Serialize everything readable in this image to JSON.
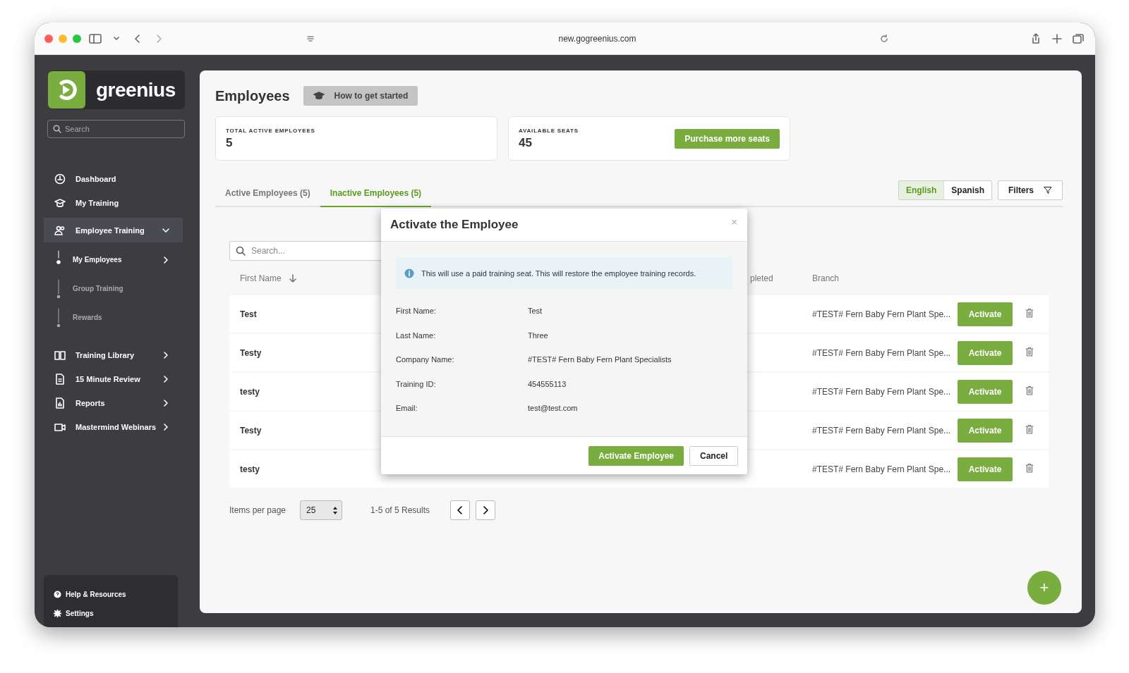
{
  "browser": {
    "url": "new.gogreenius.com"
  },
  "sidebar": {
    "logo_text": "greenius",
    "search_placeholder": "Search",
    "nav": [
      {
        "label": "Dashboard",
        "selected": false
      },
      {
        "label": "My Training",
        "selected": false
      },
      {
        "label": "Employee Training",
        "selected": true,
        "expanded": true,
        "children": [
          {
            "label": "My Employees",
            "selected": true
          },
          {
            "label": "Group Training",
            "selected": false
          },
          {
            "label": "Rewards",
            "selected": false
          }
        ]
      },
      {
        "label": "Training Library",
        "selected": false,
        "expanded": false
      },
      {
        "label": "15 Minute Review",
        "selected": false,
        "expanded": false
      },
      {
        "label": "Reports",
        "selected": false,
        "expanded": false
      },
      {
        "label": "Mastermind Webinars",
        "selected": false,
        "expanded": false
      }
    ],
    "footer": [
      {
        "label": "Help & Resources"
      },
      {
        "label": "Settings"
      }
    ]
  },
  "main": {
    "title": "Employees",
    "help_button": "How to get started",
    "stats": [
      {
        "label": "TOTAL ACTIVE EMPLOYEES",
        "value": "5"
      },
      {
        "label": "AVAILABLE SEATS",
        "value": "45",
        "action": "Purchase more seats"
      }
    ],
    "tabs": [
      {
        "label": "Active Employees (5)",
        "selected": false
      },
      {
        "label": "Inactive Employees (5)",
        "selected": true
      }
    ],
    "languages": [
      {
        "label": "English",
        "selected": true
      },
      {
        "label": "Spanish",
        "selected": false
      }
    ],
    "filters_button": "Filters",
    "table": {
      "search_placeholder": "Search...",
      "columns": [
        {
          "label": "First Name",
          "sorted": true
        },
        {
          "label": "pleted",
          "sorted": false
        },
        {
          "label": "Branch",
          "sorted": false
        }
      ],
      "rows": [
        {
          "first_name": "Test",
          "branch": "#TEST# Fern Baby Fern Plant Spe...",
          "action": "Activate"
        },
        {
          "first_name": "Testy",
          "branch": "#TEST# Fern Baby Fern Plant Spe...",
          "action": "Activate"
        },
        {
          "first_name": "testy",
          "branch": "#TEST# Fern Baby Fern Plant Spe...",
          "action": "Activate"
        },
        {
          "first_name": "Testy",
          "branch": "#TEST# Fern Baby Fern Plant Spe...",
          "action": "Activate"
        },
        {
          "first_name": "testy",
          "branch": "#TEST# Fern Baby Fern Plant Spe...",
          "action": "Activate"
        }
      ]
    },
    "pagination": {
      "label": "Items per page",
      "per_page": "25",
      "summary": "1-5 of 5 Results"
    },
    "fab": "+"
  },
  "modal": {
    "title": "Activate the Employee",
    "close": "×",
    "notice": "This will use a paid training seat. This will restore the employee training records.",
    "fields": [
      {
        "label": "First Name:",
        "value": "Test"
      },
      {
        "label": "Last Name:",
        "value": "Three"
      },
      {
        "label": "Company Name:",
        "value": "#TEST# Fern Baby Fern Plant Specialists"
      },
      {
        "label": "Training ID:",
        "value": "454555113"
      },
      {
        "label": "Email:",
        "value": "test@test.com"
      }
    ],
    "buttons": [
      {
        "label": "Activate Employee",
        "kind": "primary"
      },
      {
        "label": "Cancel",
        "kind": "secondary"
      }
    ]
  }
}
